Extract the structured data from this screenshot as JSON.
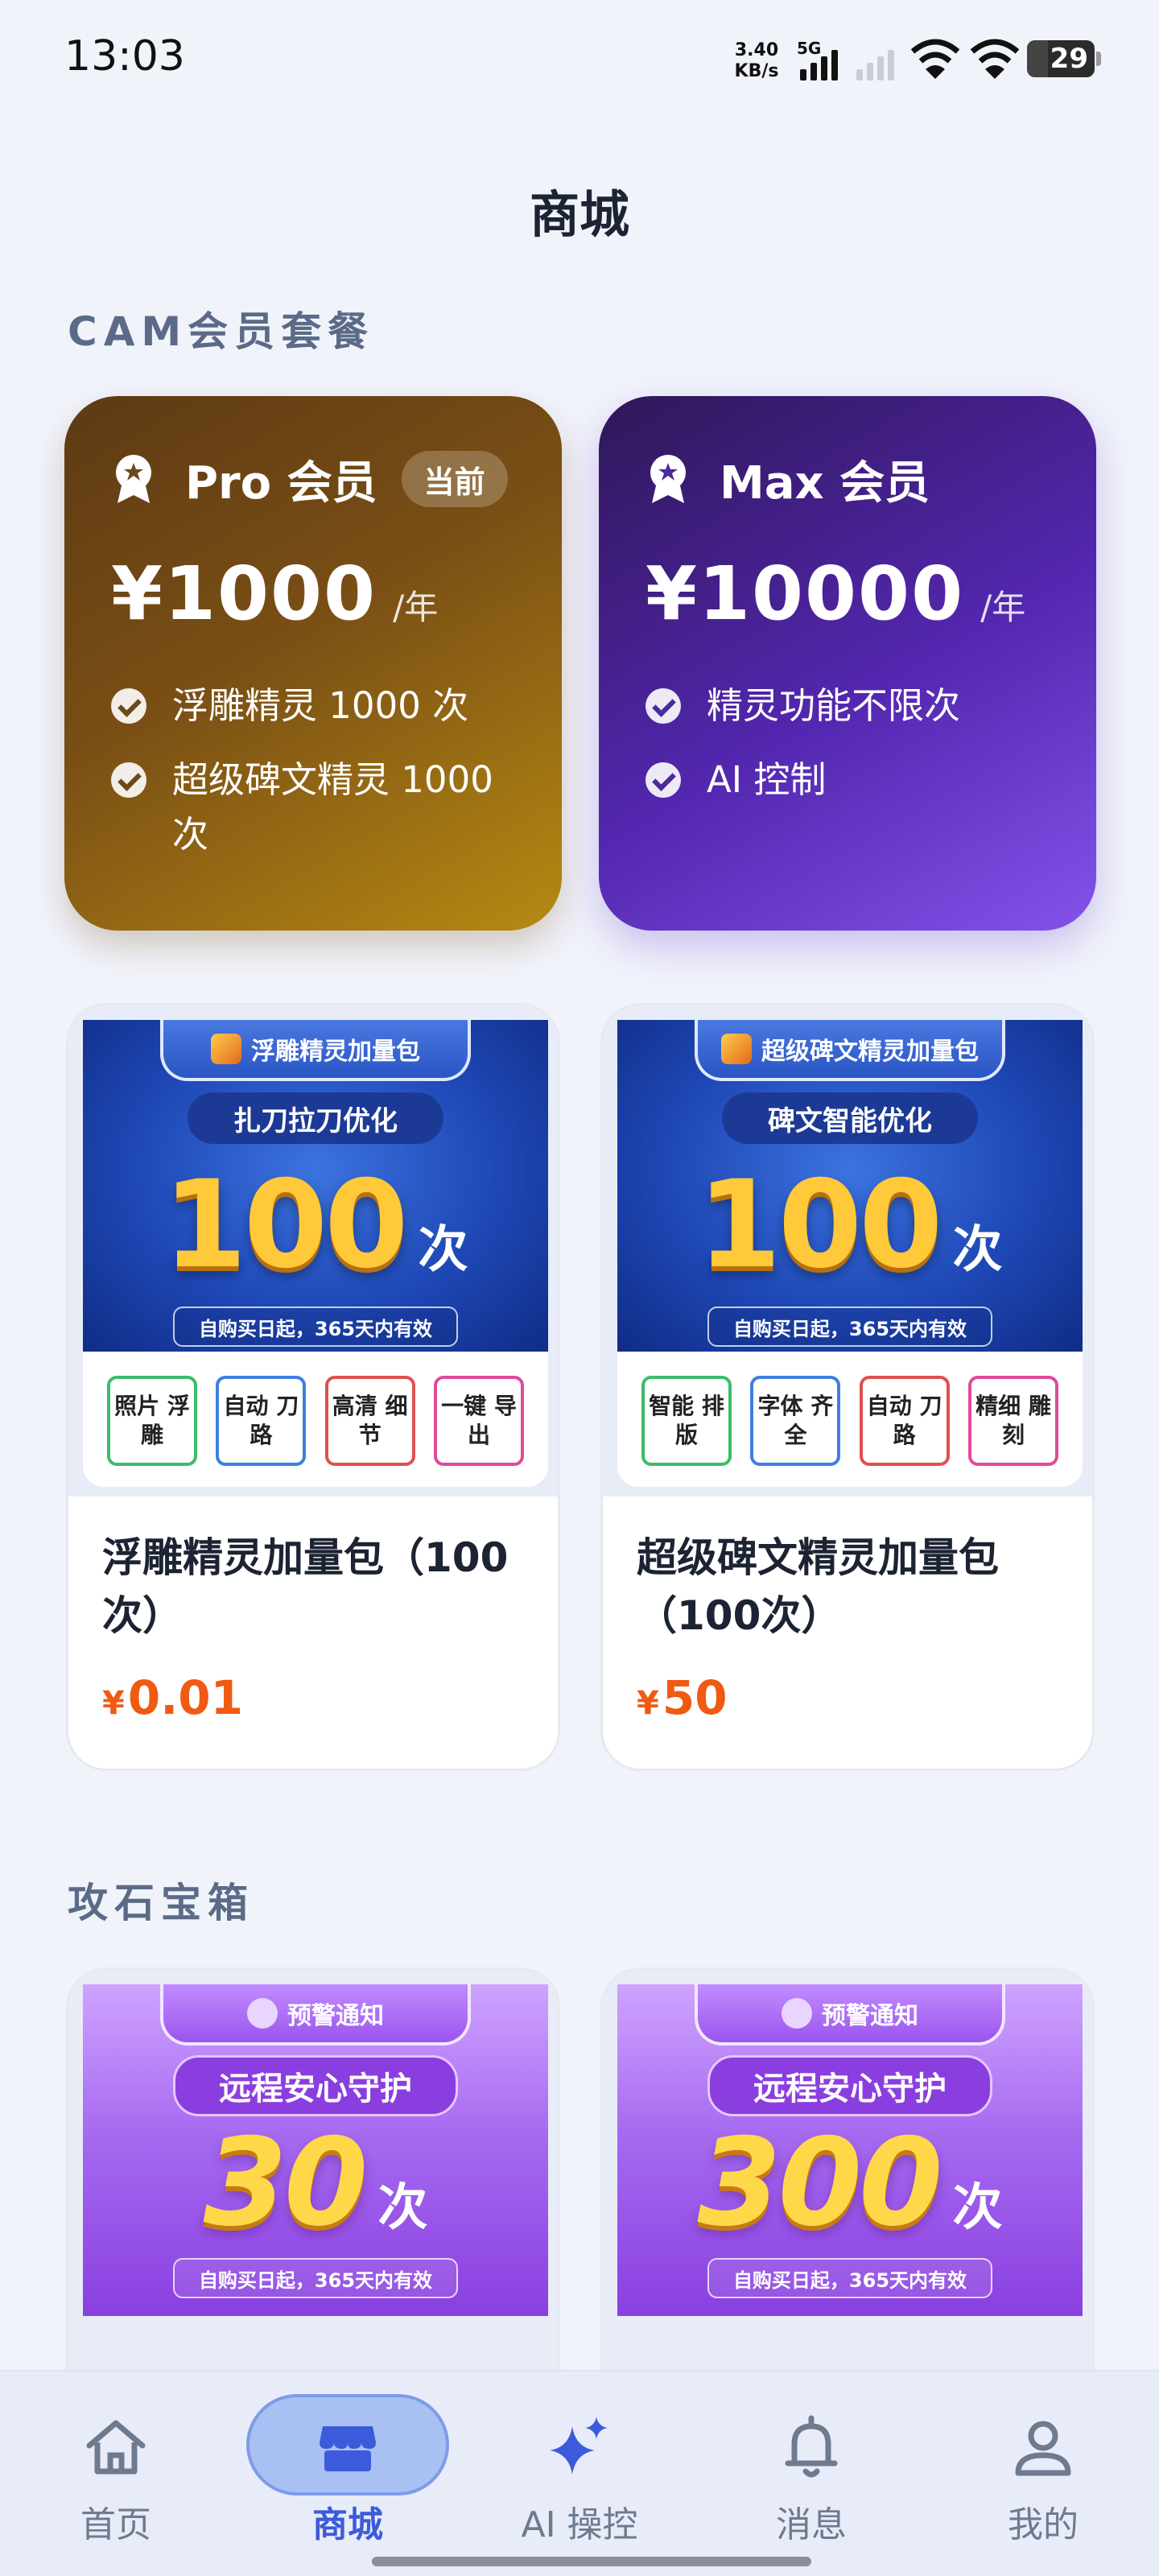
{
  "status_bar": {
    "time": "13:03",
    "speed": "3.40",
    "speed_unit": "KB/s",
    "network": "5G",
    "battery": "29"
  },
  "page_title": "商城",
  "sections": {
    "membership": "CAM会员套餐",
    "stone_box": "攻石宝箱"
  },
  "memberships": [
    {
      "name": "Pro 会员",
      "badge": "当前",
      "price": "¥1000",
      "period": "/年",
      "features": [
        "浮雕精灵 1000 次",
        "超级碑文精灵 1000 次"
      ]
    },
    {
      "name": "Max 会员",
      "price": "¥10000",
      "period": "/年",
      "features": [
        "精灵功能不限次",
        "AI 控制"
      ]
    }
  ],
  "products": [
    {
      "banner_tab": "浮雕精灵加量包",
      "banner_sub": "扎刀拉刀优化",
      "count": "100",
      "unit": "次",
      "note": "自购买日起，365天内有效",
      "chips": [
        "照片 浮雕",
        "自动 刀路",
        "高清 细节",
        "一键 导出"
      ],
      "name": "浮雕精灵加量包（100次）",
      "currency": "¥",
      "price": "0.01"
    },
    {
      "banner_tab": "超级碑文精灵加量包",
      "banner_sub": "碑文智能优化",
      "count": "100",
      "unit": "次",
      "note": "自购买日起，365天内有效",
      "chips": [
        "智能 排版",
        "字体 齐全",
        "自动 刀路",
        "精细 雕刻"
      ],
      "name": "超级碑文精灵加量包（100次）",
      "currency": "¥",
      "price": "50"
    },
    {
      "banner_tab": "预警通知",
      "banner_sub": "远程安心守护",
      "count": "30",
      "unit": "次",
      "note": "自购买日起，365天内有效"
    },
    {
      "banner_tab": "预警通知",
      "banner_sub": "远程安心守护",
      "count": "300",
      "unit": "次",
      "note": "自购买日起，365天内有效"
    }
  ],
  "nav": [
    {
      "label": "首页",
      "icon": "home-icon"
    },
    {
      "label": "商城",
      "icon": "store-icon",
      "active": true
    },
    {
      "label": "AI 操控",
      "icon": "sparkle-icon"
    },
    {
      "label": "消息",
      "icon": "bell-icon"
    },
    {
      "label": "我的",
      "icon": "user-icon"
    }
  ],
  "colors": {
    "accent": "#3b5bdb",
    "price": "#f05a12",
    "pro_gold": "#b68a12",
    "max_purple": "#5327b0"
  }
}
